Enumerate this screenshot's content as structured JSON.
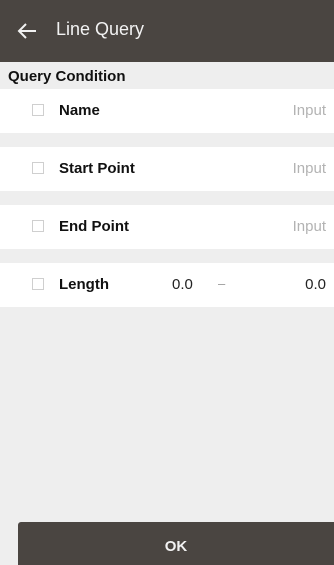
{
  "header": {
    "title": "Line Query",
    "back_icon": "arrow-left-icon"
  },
  "section": {
    "title": "Query Condition"
  },
  "rows": [
    {
      "label": "Name",
      "placeholder": "Input",
      "checked": false
    },
    {
      "label": "Start Point",
      "placeholder": "Input",
      "checked": false
    },
    {
      "label": "End Point",
      "placeholder": "Input",
      "checked": false
    }
  ],
  "length": {
    "label": "Length",
    "min": "0.0",
    "separator": "–",
    "max": "0.0",
    "checked": false
  },
  "ok_button": {
    "label": "OK"
  },
  "colors": {
    "bar": "#4a4541",
    "background": "#eeeeee",
    "row": "#ffffff",
    "placeholder": "#b3b3b3"
  }
}
